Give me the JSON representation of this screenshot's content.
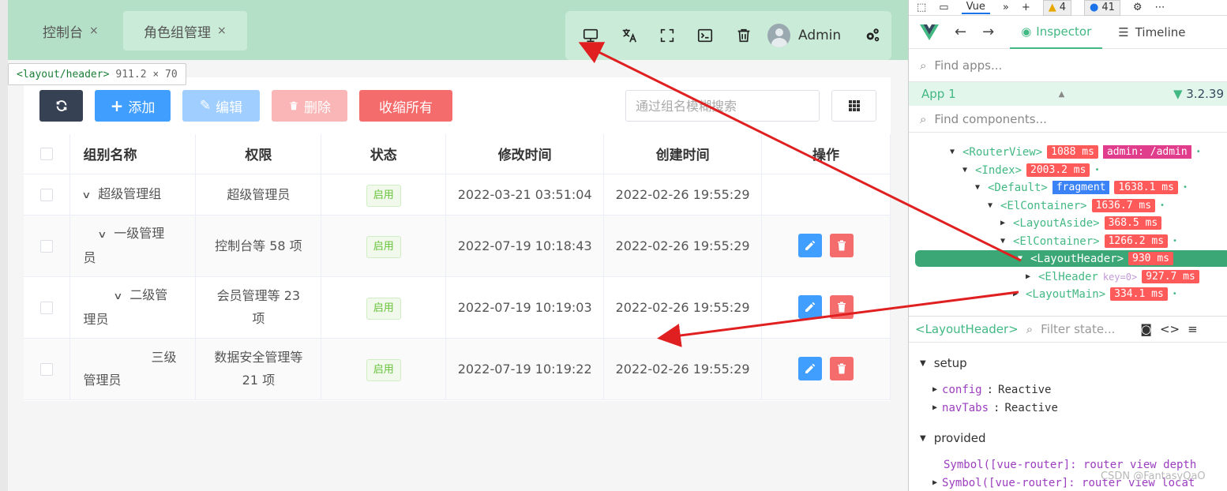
{
  "header": {
    "tabs": [
      {
        "label": "控制台",
        "close": "×"
      },
      {
        "label": "角色组管理",
        "close": "×"
      }
    ],
    "user_name": "Admin",
    "icons": [
      "monitor-icon",
      "translate-icon",
      "fullscreen-icon",
      "terminal-icon",
      "trash-icon",
      "avatar",
      "gears-icon"
    ]
  },
  "hover_tip": {
    "tag": "<layout/header>",
    "size": "911.2 × 70"
  },
  "toolbar": {
    "add_label": "添加",
    "edit_label": "编辑",
    "delete_label": "删除",
    "collapse_label": "收缩所有",
    "search_placeholder": "通过组名模糊搜索"
  },
  "table": {
    "columns": [
      "组别名称",
      "权限",
      "状态",
      "修改时间",
      "创建时间",
      "操作"
    ],
    "rows": [
      {
        "name": "超级管理组",
        "indent": 0,
        "expand": true,
        "rules": "超级管理员",
        "status": "启用",
        "updated": "2022-03-21 03:51:04",
        "created": "2022-02-26 19:55:29",
        "ops": false
      },
      {
        "name_line1": "一级管理",
        "name_line2": "员",
        "indent": 1,
        "expand": true,
        "rules": "控制台等 58 项",
        "status": "启用",
        "updated": "2022-07-19 10:18:43",
        "created": "2022-02-26 19:55:29",
        "ops": true
      },
      {
        "name_line1": "二级管",
        "name_line2": "理员",
        "indent": 2,
        "expand": true,
        "rules_line1": "会员管理等 23",
        "rules_line2": "项",
        "status": "启用",
        "updated": "2022-07-19 10:19:03",
        "created": "2022-02-26 19:55:29",
        "ops": true
      },
      {
        "name_line1": "三级",
        "name_line2": "管理员",
        "indent": 3,
        "expand": false,
        "rules_line1": "数据安全管理等",
        "rules_line2": "21 项",
        "status": "启用",
        "updated": "2022-07-19 10:19:22",
        "created": "2022-02-26 19:55:29",
        "ops": true
      }
    ]
  },
  "devtools": {
    "top": {
      "vue_tab": "Vue",
      "warnings": "4",
      "messages": "41"
    },
    "nav": {
      "inspector": "Inspector",
      "timeline": "Timeline"
    },
    "find_apps": "Find apps...",
    "app": {
      "name": "App 1",
      "version": "3.2.39"
    },
    "find_components": "Find components...",
    "tree": [
      {
        "label": "<RouterView>",
        "time": "1088 ms",
        "route": "admin: /admin",
        "indent": 0,
        "tri": "▼"
      },
      {
        "label": "<Index>",
        "time": "2003.2 ms",
        "indent": 1,
        "tri": "▼"
      },
      {
        "label": "<Default>",
        "frag": "fragment",
        "time": "1638.1 ms",
        "indent": 2,
        "tri": "▼"
      },
      {
        "label": "<ElContainer>",
        "time": "1636.7 ms",
        "indent": 3,
        "tri": "▼"
      },
      {
        "label": "<LayoutAside>",
        "time": "368.5 ms",
        "indent": 4,
        "tri": "▶"
      },
      {
        "label": "<ElContainer>",
        "time": "1266.2 ms",
        "indent": 4,
        "tri": "▼"
      },
      {
        "label": "<LayoutHeader>",
        "time": "930 ms",
        "indent": 5,
        "tri": "▼",
        "selected": true
      },
      {
        "label": "<ElHeader",
        "key": "key=0>",
        "time": "927.7 ms",
        "indent": 6,
        "tri": "▶"
      },
      {
        "label": "<LayoutMain>",
        "time": "334.1 ms",
        "indent": 5,
        "tri": "▶"
      }
    ],
    "state_header": {
      "component": "<LayoutHeader>",
      "filter": "Filter state..."
    },
    "setup": {
      "title": "setup",
      "props": [
        {
          "key": "config",
          "value": "Reactive"
        },
        {
          "key": "navTabs",
          "value": "Reactive"
        }
      ]
    },
    "provided": {
      "title": "provided",
      "items": [
        "Symbol([vue-router]: router view depth",
        "Symbol([vue-router]: router view locat"
      ]
    }
  },
  "watermark": "CSDN @FantasyQaO",
  "colors": {
    "header_bg": "#b5e0c8",
    "primary": "#409eff",
    "danger": "#f56c6c",
    "success": "#67c23a",
    "vue_green": "#42b883",
    "arrow": "#e02020"
  }
}
